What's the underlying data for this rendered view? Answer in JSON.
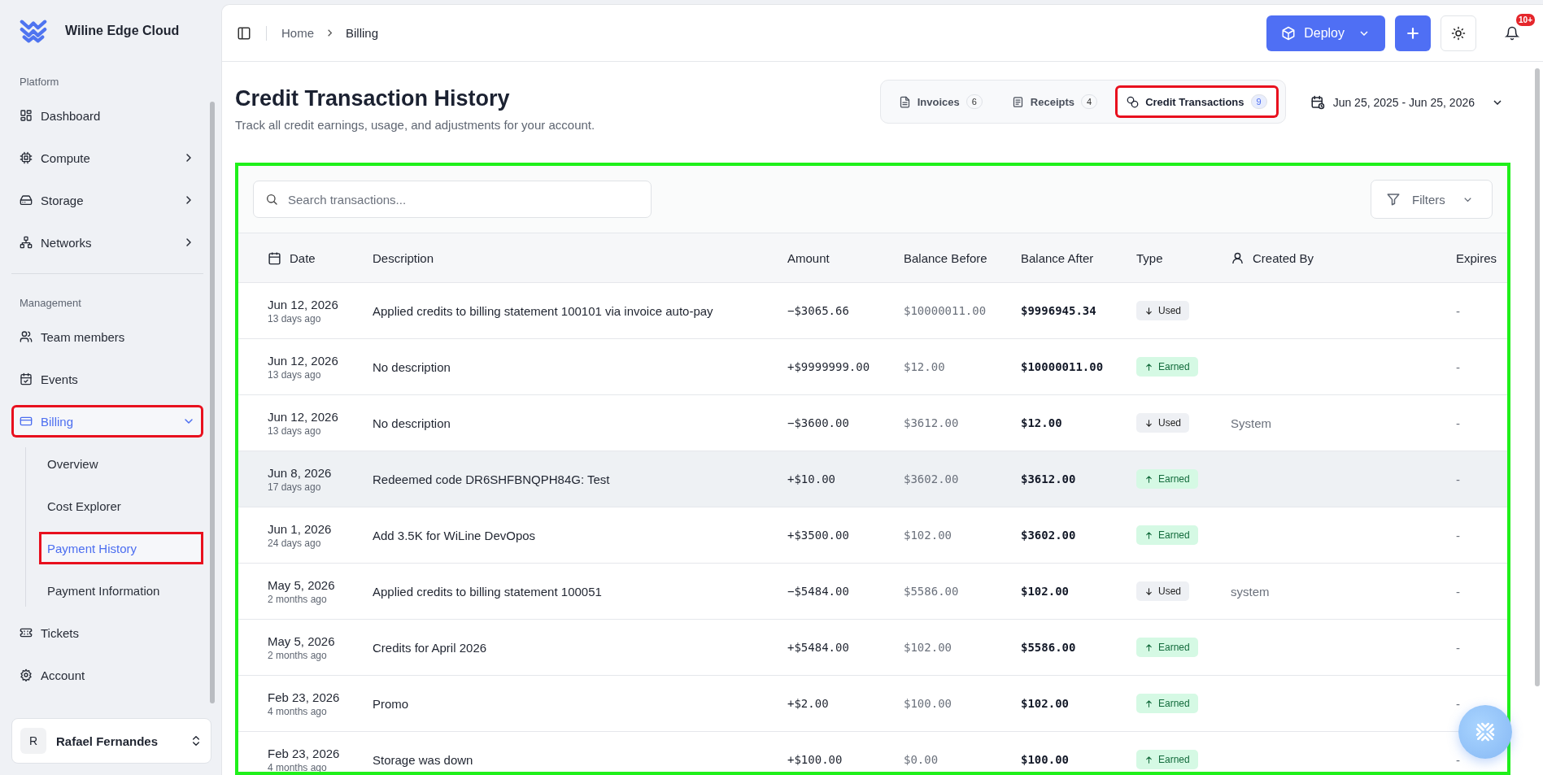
{
  "brand": {
    "name": "Wiline Edge Cloud"
  },
  "sidebar": {
    "sections": [
      {
        "title": "Platform",
        "items": [
          {
            "label": "Dashboard",
            "kind": "link",
            "selected": false,
            "highlighted": false
          },
          {
            "label": "Compute",
            "kind": "group",
            "expanded": false,
            "selected": false,
            "highlighted": false
          },
          {
            "label": "Storage",
            "kind": "group",
            "expanded": false,
            "selected": false,
            "highlighted": false
          },
          {
            "label": "Networks",
            "kind": "group",
            "expanded": false,
            "selected": false,
            "highlighted": false
          }
        ]
      },
      {
        "title": "Management",
        "items": [
          {
            "label": "Team members",
            "kind": "link",
            "selected": false,
            "highlighted": false
          },
          {
            "label": "Events",
            "kind": "link",
            "selected": false,
            "highlighted": false
          },
          {
            "label": "Billing",
            "kind": "group",
            "expanded": true,
            "selected": true,
            "highlighted": true,
            "children": [
              {
                "label": "Overview",
                "selected": false,
                "highlighted": false
              },
              {
                "label": "Cost Explorer",
                "selected": false,
                "highlighted": false
              },
              {
                "label": "Payment History",
                "selected": true,
                "highlighted": true
              },
              {
                "label": "Payment Information",
                "selected": false,
                "highlighted": false
              }
            ]
          },
          {
            "label": "Tickets",
            "kind": "link",
            "selected": false,
            "highlighted": false
          },
          {
            "label": "Account",
            "kind": "link",
            "selected": false,
            "highlighted": false
          }
        ]
      }
    ],
    "user": {
      "initial": "R",
      "name": "Rafael Fernandes"
    }
  },
  "breadcrumb": [
    "Home",
    "Billing"
  ],
  "topbar": {
    "deploy": "Deploy",
    "notifications_badge": "10+"
  },
  "page": {
    "title": "Credit Transaction History",
    "subtitle": "Track all credit earnings, usage, and adjustments for your account."
  },
  "tabs": [
    {
      "label": "Invoices",
      "count": "6",
      "selected": false,
      "highlighted": false
    },
    {
      "label": "Receipts",
      "count": "4",
      "selected": false,
      "highlighted": false
    },
    {
      "label": "Credit Transactions",
      "count": "9",
      "selected": true,
      "highlighted": true
    }
  ],
  "date_range": "Jun 25, 2025 - Jun 25, 2026",
  "table": {
    "highlighted": true,
    "search": {
      "placeholder": "Search transactions..."
    },
    "filters": "Filters",
    "columns": [
      "Date",
      "Description",
      "Amount",
      "Balance Before",
      "Balance After",
      "Type",
      "Created By",
      "Expires"
    ],
    "rows": [
      {
        "date": "Jun 12, 2026",
        "ago": "13 days ago",
        "description": "Applied credits to billing statement 100101 via invoice auto-pay",
        "amount": "−$3065.66",
        "balance_before": "$10000011.00",
        "balance_after": "$9996945.34",
        "type": {
          "label": "Used",
          "kind": "used"
        },
        "expires": "-",
        "hovered": false
      },
      {
        "date": "Jun 12, 2026",
        "ago": "13 days ago",
        "description": "No description",
        "amount": "+$9999999.00",
        "balance_before": "$12.00",
        "balance_after": "$10000011.00",
        "type": {
          "label": "Earned",
          "kind": "earned"
        },
        "expires": "-",
        "hovered": false
      },
      {
        "date": "Jun 12, 2026",
        "ago": "13 days ago",
        "description": "No description",
        "amount": "−$3600.00",
        "balance_before": "$3612.00",
        "balance_after": "$12.00",
        "type": {
          "label": "Used",
          "kind": "used"
        },
        "created_by": "System",
        "expires": "-",
        "hovered": false
      },
      {
        "date": "Jun 8, 2026",
        "ago": "17 days ago",
        "description": "Redeemed code DR6SHFBNQPH84G: Test",
        "amount": "+$10.00",
        "balance_before": "$3602.00",
        "balance_after": "$3612.00",
        "type": {
          "label": "Earned",
          "kind": "earned"
        },
        "expires": "-",
        "hovered": true
      },
      {
        "date": "Jun 1, 2026",
        "ago": "24 days ago",
        "description": "Add 3.5K for WiLine DevOpos",
        "amount": "+$3500.00",
        "balance_before": "$102.00",
        "balance_after": "$3602.00",
        "type": {
          "label": "Earned",
          "kind": "earned"
        },
        "expires": "-",
        "hovered": false
      },
      {
        "date": "May 5, 2026",
        "ago": "2 months ago",
        "description": "Applied credits to billing statement 100051",
        "amount": "−$5484.00",
        "balance_before": "$5586.00",
        "balance_after": "$102.00",
        "type": {
          "label": "Used",
          "kind": "used"
        },
        "created_by": "system",
        "expires": "-",
        "hovered": false
      },
      {
        "date": "May 5, 2026",
        "ago": "2 months ago",
        "description": "Credits for April 2026",
        "amount": "+$5484.00",
        "balance_before": "$102.00",
        "balance_after": "$5586.00",
        "type": {
          "label": "Earned",
          "kind": "earned"
        },
        "expires": "-",
        "hovered": false
      },
      {
        "date": "Feb 23, 2026",
        "ago": "4 months ago",
        "description": "Promo",
        "amount": "+$2.00",
        "balance_before": "$100.00",
        "balance_after": "$102.00",
        "type": {
          "label": "Earned",
          "kind": "earned"
        },
        "expires": "-",
        "hovered": false
      },
      {
        "date": "Feb 23, 2026",
        "ago": "4 months ago",
        "description": "Storage was down",
        "amount": "+$100.00",
        "balance_before": "$0.00",
        "balance_after": "$100.00",
        "type": {
          "label": "Earned",
          "kind": "earned"
        },
        "expires": "-",
        "hovered": false
      }
    ]
  }
}
